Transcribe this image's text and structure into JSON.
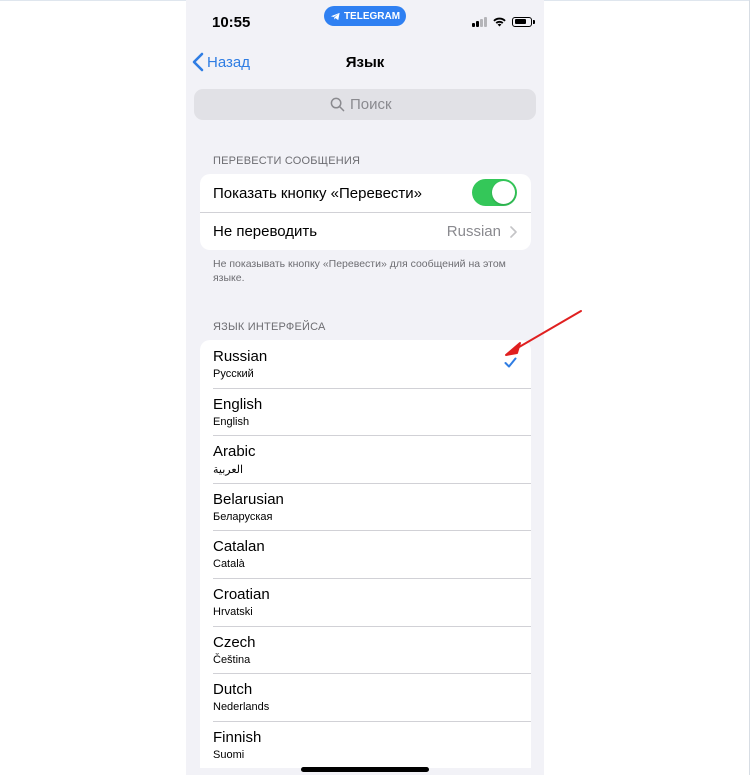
{
  "status_bar": {
    "time": "10:55",
    "app_pill": "TELEGRAM"
  },
  "nav": {
    "back_label": "Назад",
    "title": "Язык"
  },
  "search": {
    "placeholder": "Поиск"
  },
  "translate_section": {
    "header": "ПЕРЕВЕСТИ СООБЩЕНИЯ",
    "show_button_label": "Показать кнопку «Перевести»",
    "show_button_enabled": true,
    "dont_translate_label": "Не переводить",
    "dont_translate_value": "Russian",
    "footer": "Не показывать кнопку «Перевести» для сообщений на этом языке."
  },
  "interface_section": {
    "header": "ЯЗЫК ИНТЕРФЕЙСА",
    "languages": [
      {
        "name": "Russian",
        "native": "Русский",
        "selected": true
      },
      {
        "name": "English",
        "native": "English",
        "selected": false
      },
      {
        "name": "Arabic",
        "native": "العربية",
        "selected": false
      },
      {
        "name": "Belarusian",
        "native": "Беларуская",
        "selected": false
      },
      {
        "name": "Catalan",
        "native": "Català",
        "selected": false
      },
      {
        "name": "Croatian",
        "native": "Hrvatski",
        "selected": false
      },
      {
        "name": "Czech",
        "native": "Čeština",
        "selected": false
      },
      {
        "name": "Dutch",
        "native": "Nederlands",
        "selected": false
      },
      {
        "name": "Finnish",
        "native": "Suomi",
        "selected": false
      }
    ]
  },
  "colors": {
    "accent": "#2f7de3",
    "toggle_on": "#34c759",
    "annotation_arrow": "#e02020",
    "background": "#f2f2f7"
  },
  "icons": {
    "back": "chevron-left-icon",
    "search": "search-icon",
    "check": "checkmark-icon",
    "disclosure": "chevron-right-icon"
  }
}
